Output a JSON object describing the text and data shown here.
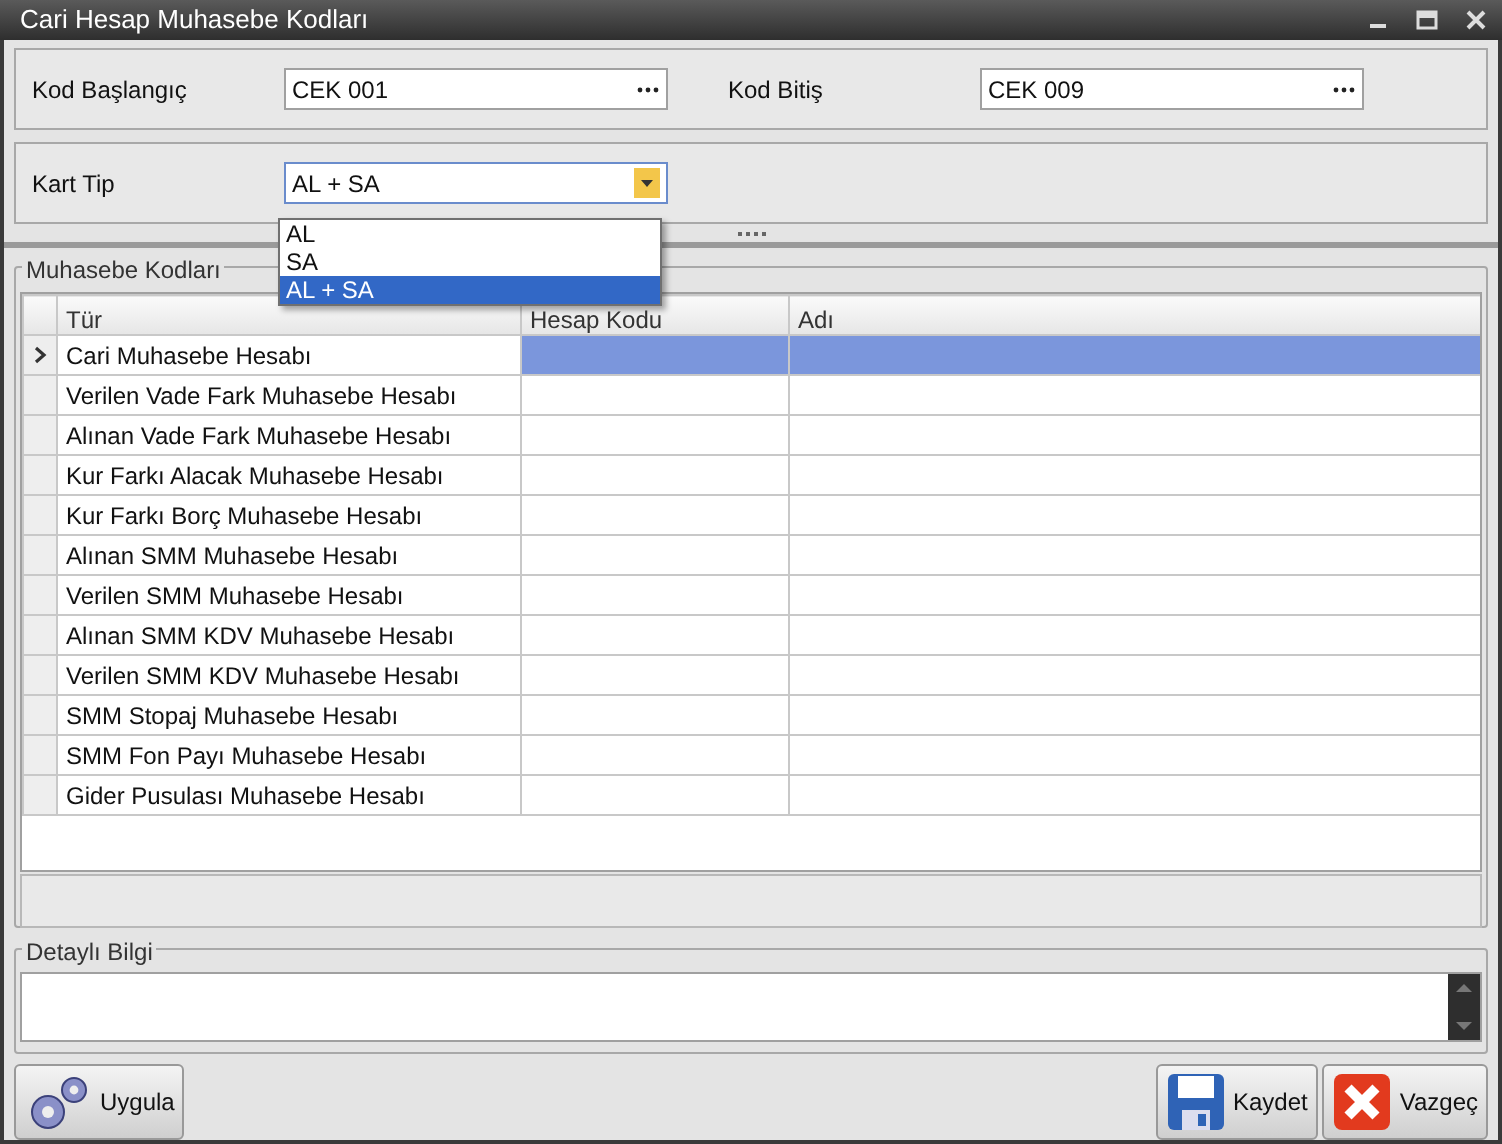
{
  "window": {
    "title": "Cari Hesap Muhasebe Kodları"
  },
  "range": [
    {
      "label": "Kod Başlangıç",
      "value": "CEK 001"
    },
    {
      "label": "Kod Bitiş",
      "value": "CEK 009"
    }
  ],
  "kart_tip": {
    "label": "Kart Tip",
    "value": "AL + SA",
    "expanded": true,
    "options": [
      {
        "label": "AL",
        "selected": false
      },
      {
        "label": "SA",
        "selected": false
      },
      {
        "label": "AL + SA",
        "selected": true
      }
    ]
  },
  "muhasebe_kodlari": {
    "title": "Muhasebe Kodları",
    "columns": [
      "Tür",
      "Hesap Kodu",
      "Adı"
    ],
    "rows": [
      {
        "type": "Cari Muhasebe Hesabı",
        "selected": true
      },
      {
        "type": "Verilen Vade Fark Muhasebe Hesabı",
        "selected": false
      },
      {
        "type": "Alınan Vade Fark Muhasebe Hesabı",
        "selected": false
      },
      {
        "type": "Kur Farkı Alacak Muhasebe Hesabı",
        "selected": false
      },
      {
        "type": "Kur Farkı Borç Muhasebe Hesabı",
        "selected": false
      },
      {
        "type": "Alınan SMM Muhasebe Hesabı",
        "selected": false
      },
      {
        "type": "Verilen SMM Muhasebe Hesabı",
        "selected": false
      },
      {
        "type": "Alınan SMM KDV Muhasebe Hesabı",
        "selected": false
      },
      {
        "type": "Verilen SMM KDV Muhasebe Hesabı",
        "selected": false
      },
      {
        "type": "SMM Stopaj Muhasebe Hesabı",
        "selected": false
      },
      {
        "type": "SMM Fon Payı Muhasebe Hesabı",
        "selected": false
      },
      {
        "type": "Gider Pusulası Muhasebe Hesabı",
        "selected": false
      }
    ]
  },
  "detayli_bilgi": {
    "title": "Detaylı Bilgi"
  },
  "buttons": [
    {
      "label": "Uygula",
      "kind": "apply"
    },
    {
      "label": "Kaydet",
      "kind": "save"
    },
    {
      "label": "Vazgeç",
      "kind": "cancel"
    }
  ]
}
